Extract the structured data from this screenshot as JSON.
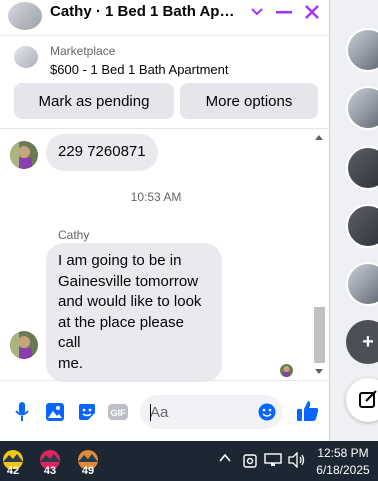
{
  "chat": {
    "title": "Cathy · 1 Bed 1 Bath Apartment",
    "listing": {
      "label": "Marketplace",
      "title": "$600 - 1 Bed 1 Bath Apartment",
      "mark_pending_label": "Mark as pending",
      "more_options_label": "More options"
    },
    "messages": {
      "phone_message": "229 7260871",
      "timestamp": "10:53 AM",
      "sender": "Cathy",
      "lines": [
        "I am going to be in",
        "Gainesville tomorrow",
        "and would like to look",
        "at the place please call",
        "me."
      ]
    },
    "composer": {
      "placeholder": "Aa"
    }
  },
  "taskbar": {
    "apps": [
      {
        "badge": "42"
      },
      {
        "badge": "43"
      },
      {
        "badge": "49"
      }
    ],
    "clock_time": "12:58 PM",
    "clock_date": "6/18/2025"
  },
  "colors": {
    "accent": "#a033ff",
    "messenger_blue": "#0866ff",
    "bubble": "#e9eaed",
    "taskbar": "#1d2733"
  }
}
